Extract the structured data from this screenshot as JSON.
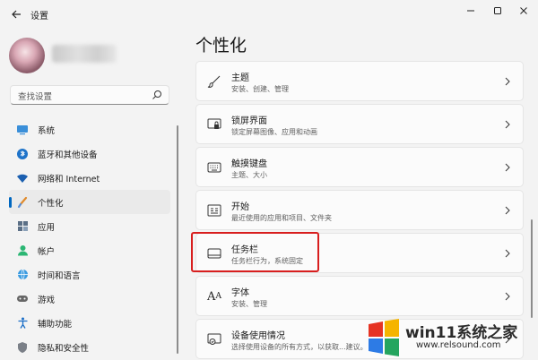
{
  "window": {
    "title": "设置",
    "back_icon": "back-arrow-icon",
    "buttons": [
      "minimize-icon",
      "maximize-icon",
      "close-icon"
    ]
  },
  "search": {
    "placeholder": "查找设置",
    "icon": "search-icon"
  },
  "sidebar": {
    "items": [
      {
        "label": "系统",
        "icon": "monitor-icon"
      },
      {
        "label": "蓝牙和其他设备",
        "icon": "bluetooth-icon"
      },
      {
        "label": "网络和 Internet",
        "icon": "wifi-icon"
      },
      {
        "label": "个性化",
        "icon": "paintbrush-icon",
        "active": true
      },
      {
        "label": "应用",
        "icon": "apps-icon"
      },
      {
        "label": "帐户",
        "icon": "person-icon"
      },
      {
        "label": "时间和语言",
        "icon": "globe-icon"
      },
      {
        "label": "游戏",
        "icon": "gamepad-icon"
      },
      {
        "label": "辅助功能",
        "icon": "accessibility-icon"
      },
      {
        "label": "隐私和安全性",
        "icon": "shield-icon"
      }
    ]
  },
  "main": {
    "title": "个性化",
    "cards": [
      {
        "title": "主题",
        "desc": "安装、创建、管理",
        "icon": "brush-icon"
      },
      {
        "title": "锁屏界面",
        "desc": "锁定屏幕图像、应用和动画",
        "icon": "lock-screen-icon"
      },
      {
        "title": "触摸键盘",
        "desc": "主题、大小",
        "icon": "keyboard-icon"
      },
      {
        "title": "开始",
        "desc": "最近使用的应用和项目、文件夹",
        "icon": "start-icon"
      },
      {
        "title": "任务栏",
        "desc": "任务栏行为，系统固定",
        "icon": "taskbar-icon",
        "highlighted": true
      },
      {
        "title": "字体",
        "desc": "安装、管理",
        "icon": "font-icon"
      },
      {
        "title": "设备使用情况",
        "desc": "选择使用设备的所有方式，以获取...建议。",
        "icon": "device-usage-icon"
      }
    ]
  },
  "watermark": {
    "text": "win11系统之家",
    "url": "www.relsound.com"
  },
  "colors": {
    "accent": "#0067c0",
    "highlight_border": "#d81e1e",
    "background": "#f3f3f3"
  }
}
